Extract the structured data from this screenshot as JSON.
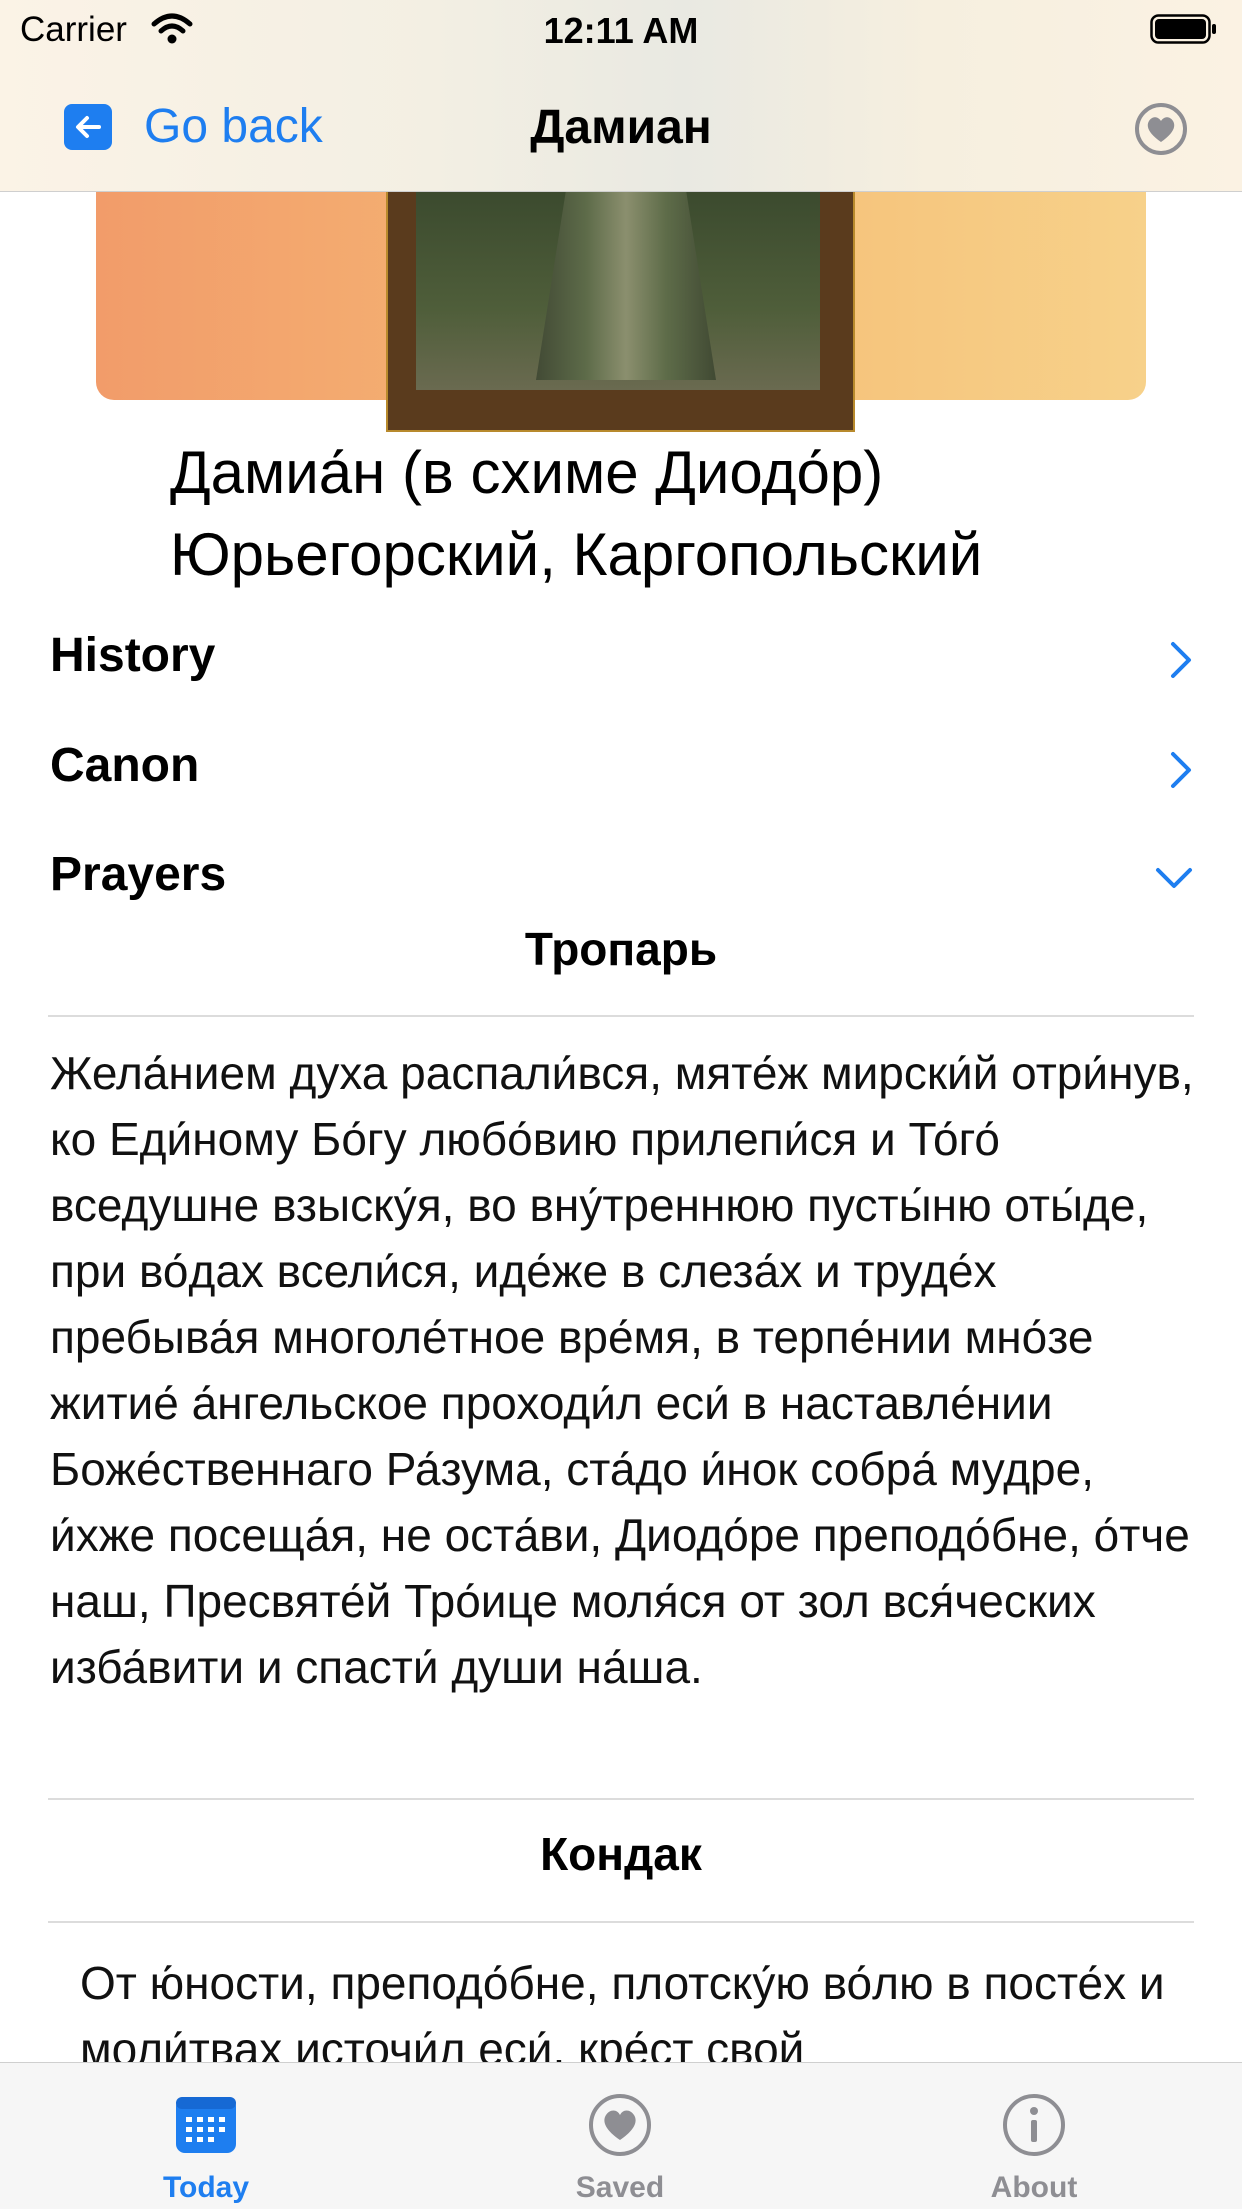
{
  "status_bar": {
    "carrier": "Carrier",
    "time": "12:11 AM"
  },
  "nav": {
    "back_label": "Go back",
    "title": "Дамиан",
    "favorite_icon": "heart-circle-icon"
  },
  "saint": {
    "name_line1": "Дамиа́н (в схиме Диодо́р)",
    "name_line2": "Юрьегорский, Каргопольский"
  },
  "rows": [
    {
      "label": "History",
      "state": "collapsed"
    },
    {
      "label": "Canon",
      "state": "collapsed"
    },
    {
      "label": "Prayers",
      "state": "expanded"
    }
  ],
  "prayers": {
    "troparion_title": "Тропарь",
    "troparion_text": "Жела́нием духа распали́вся, мяте́ж мирски́й отри́нув, ко Еди́ному Бо́гу любо́вию прилепи́ся и То́го́ вседушне взыску́я, во вну́треннюю пусты́ню оты́де, при во́дах всели́ся, иде́же в слеза́х и труде́х пребыва́я многоле́тное вре́мя, в терпе́нии мно́зе житие́ а́нгельское проходи́л еси́ в наставле́нии Боже́ственнаго Ра́зума, ста́до и́нок собра́ мудре, и́хже посеща́я, не оста́ви, Диодо́ре преподо́бне, о́тче наш, Пресвяте́й Тро́ице моля́ся от зол вся́ческих изба́вити и спасти́ души на́ша.",
    "kontakion_title": "Кондак",
    "kontakion_text": "От ю́ности, преподо́бне, плотску́ю во́лю в посте́х и моли́твах источи́л еси́, кре́ст свой"
  },
  "tabs": [
    {
      "label": "Today",
      "icon": "calendar-icon",
      "active": true
    },
    {
      "label": "Saved",
      "icon": "heart-icon",
      "active": false
    },
    {
      "label": "About",
      "icon": "info-icon",
      "active": false
    }
  ],
  "colors": {
    "accent": "#1e7ef0",
    "inactive": "#8e8e93"
  }
}
